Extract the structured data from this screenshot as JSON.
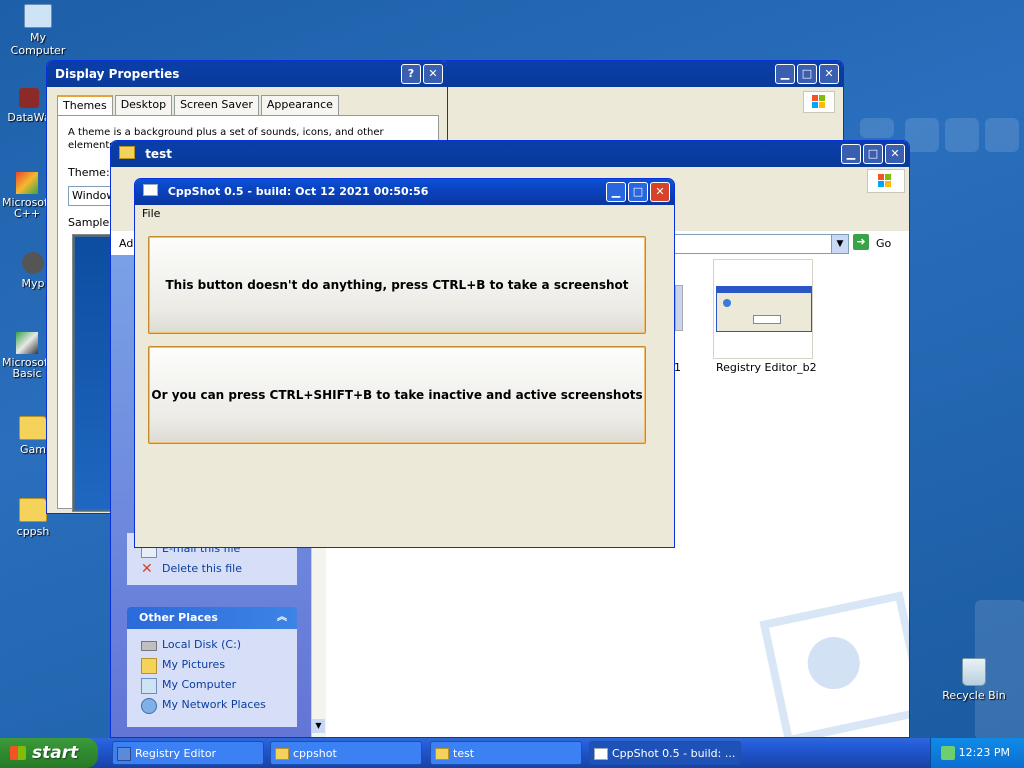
{
  "desktop": {
    "icons": [
      {
        "label": "My Computer"
      },
      {
        "label": "DataWa"
      },
      {
        "label": "Microsoft C++"
      },
      {
        "label": "Myp"
      },
      {
        "label": "Microsoft Basic"
      },
      {
        "label": "Gam"
      },
      {
        "label": "cppsh"
      },
      {
        "label": "Recycle Bin"
      }
    ]
  },
  "display_properties": {
    "title": "Display Properties",
    "help_btn": "?",
    "close_btn": "✕",
    "tabs": [
      "Themes",
      "Desktop",
      "Screen Saver",
      "Appearance"
    ],
    "description": "A theme is a background plus a set of sounds, icons, and other elements to help y",
    "theme_label": "Theme:",
    "theme_value": "Window",
    "sample_label": "Sample:"
  },
  "registry_window": {
    "min_btn": "▁",
    "max_btn": "□",
    "close_btn": "✕"
  },
  "test_window": {
    "title": "test",
    "min_btn": "▁",
    "max_btn": "□",
    "close_btn": "✕",
    "address_prefix": "Ad",
    "go_label": "Go",
    "file_tasks": [
      "E-mail this file",
      "Delete this file"
    ],
    "other_places": {
      "header": "Other Places",
      "items": [
        "Local Disk (C:)",
        "My Pictures",
        "My Computer",
        "My Network Places"
      ]
    },
    "thumbnails": [
      {
        "label": "1"
      },
      {
        "label": "Registry Editor_b2"
      }
    ]
  },
  "cppshot_window": {
    "title": "CppShot 0.5 - build: Oct 12 2021 00:50:56",
    "menu_file": "File",
    "button1": "This button doesn't do anything, press CTRL+B to take a screenshot",
    "button2": "Or you can press CTRL+SHIFT+B to take inactive and active screenshots",
    "min_btn": "▁",
    "max_btn": "□",
    "close_btn": "✕"
  },
  "taskbar": {
    "start_label": "start",
    "items": [
      {
        "label": "Registry Editor",
        "active": false
      },
      {
        "label": "cppshot",
        "active": false
      },
      {
        "label": "test",
        "active": false
      },
      {
        "label": "CppShot 0.5 - build: ...",
        "active": true
      }
    ],
    "clock": "12:23 PM"
  }
}
